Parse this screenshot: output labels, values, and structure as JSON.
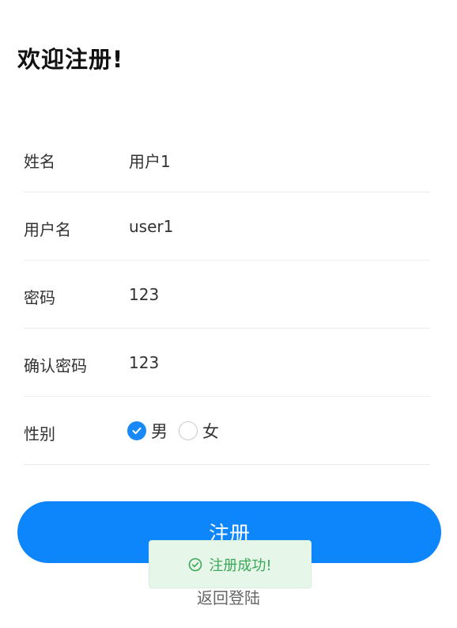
{
  "page": {
    "title": "欢迎注册!"
  },
  "form": {
    "fields": [
      {
        "label": "姓名",
        "value": "用户1"
      },
      {
        "label": "用户名",
        "value": "user1"
      },
      {
        "label": "密码",
        "value": "123"
      },
      {
        "label": "确认密码",
        "value": "123"
      }
    ],
    "gender": {
      "label": "性别",
      "options": [
        {
          "label": "男",
          "checked": true
        },
        {
          "label": "女",
          "checked": false
        }
      ]
    }
  },
  "actions": {
    "submit_label": "注册",
    "back_label": "返回登陆"
  },
  "toast": {
    "message": "注册成功!",
    "icon": "check-circle-icon",
    "type": "success"
  },
  "colors": {
    "primary": "#0e86fb",
    "radio_checked": "#1989fa",
    "toast_bg": "#e6f6e9",
    "toast_text": "#3aa856"
  }
}
